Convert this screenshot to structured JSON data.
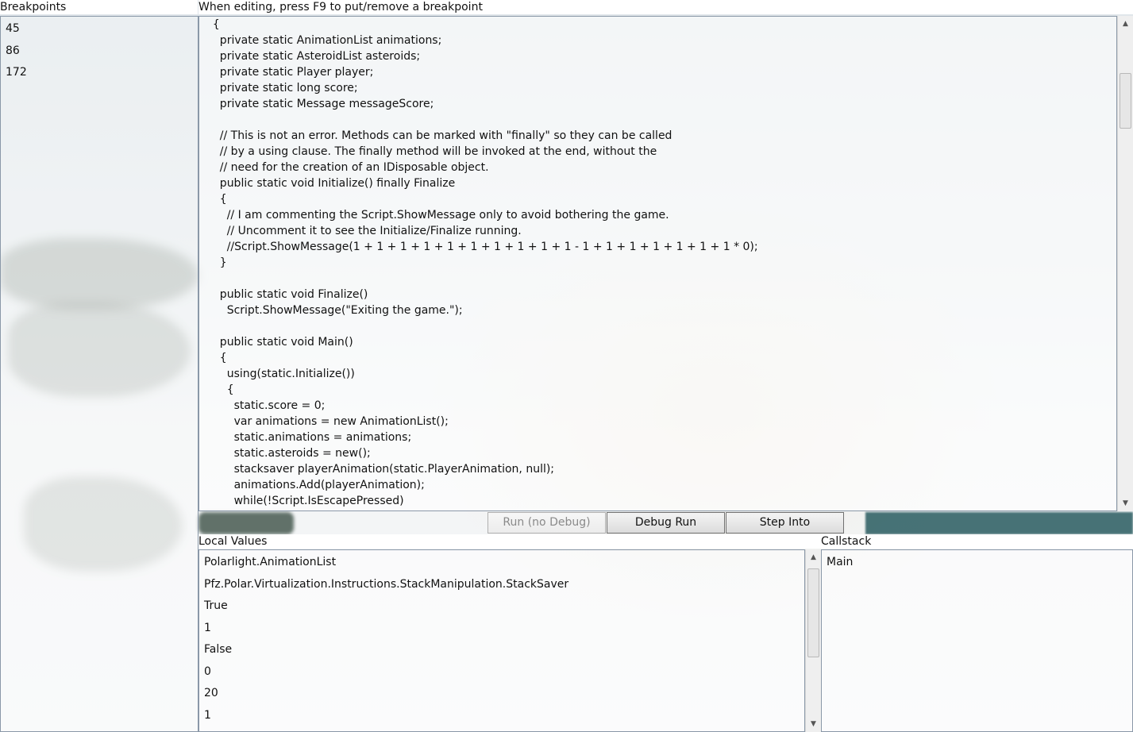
{
  "breakpoints": {
    "title": "Breakpoints",
    "items": [
      "45",
      "86",
      "172"
    ]
  },
  "editor": {
    "hint": "When editing, press F9 to put/remove a breakpoint",
    "lines": [
      "  {",
      "    private static AnimationList animations;",
      "    private static AsteroidList asteroids;",
      "    private static Player player;",
      "    private static long score;",
      "    private static Message messageScore;",
      "",
      "    // This is not an error. Methods can be marked with \"finally\" so they can be called",
      "    // by a using clause. The finally method will be invoked at the end, without the",
      "    // need for the creation of an IDisposable object.",
      "    public static void Initialize() finally Finalize",
      "    {",
      "      // I am commenting the Script.ShowMessage only to avoid bothering the game.",
      "      // Uncomment it to see the Initialize/Finalize running.",
      "      //Script.ShowMessage(1 + 1 + 1 + 1 + 1 + 1 + 1 + 1 + 1 + 1 - 1 + 1 + 1 + 1 + 1 + 1 + 1 * 0);",
      "    }",
      "",
      "    public static void Finalize()",
      "      Script.ShowMessage(\"Exiting the game.\");",
      "",
      "    public static void Main()",
      "    {",
      "      using(static.Initialize())",
      "      {",
      "        static.score = 0;",
      "        var animations = new AnimationList();",
      "        static.animations = animations;",
      "        static.asteroids = new();",
      "        stacksaver playerAnimation(static.PlayerAnimation, null);",
      "        animations.Add(playerAnimation);",
      "        while(!Script.IsEscapePressed)"
    ]
  },
  "toolbar": {
    "run_no_debug": "Run (no Debug)",
    "debug_run": "Debug Run",
    "step_into": "Step Into"
  },
  "locals": {
    "title": "Local Values",
    "items": [
      "Polarlight.AnimationList",
      "Pfz.Polar.Virtualization.Instructions.StackManipulation.StackSaver",
      "True",
      "1",
      "False",
      "0",
      "20",
      "1"
    ]
  },
  "callstack": {
    "title": "Callstack",
    "items": [
      "Main"
    ]
  },
  "icons": {
    "scroll_up": "scroll-up-arrow-icon",
    "scroll_down": "scroll-down-arrow-icon"
  }
}
